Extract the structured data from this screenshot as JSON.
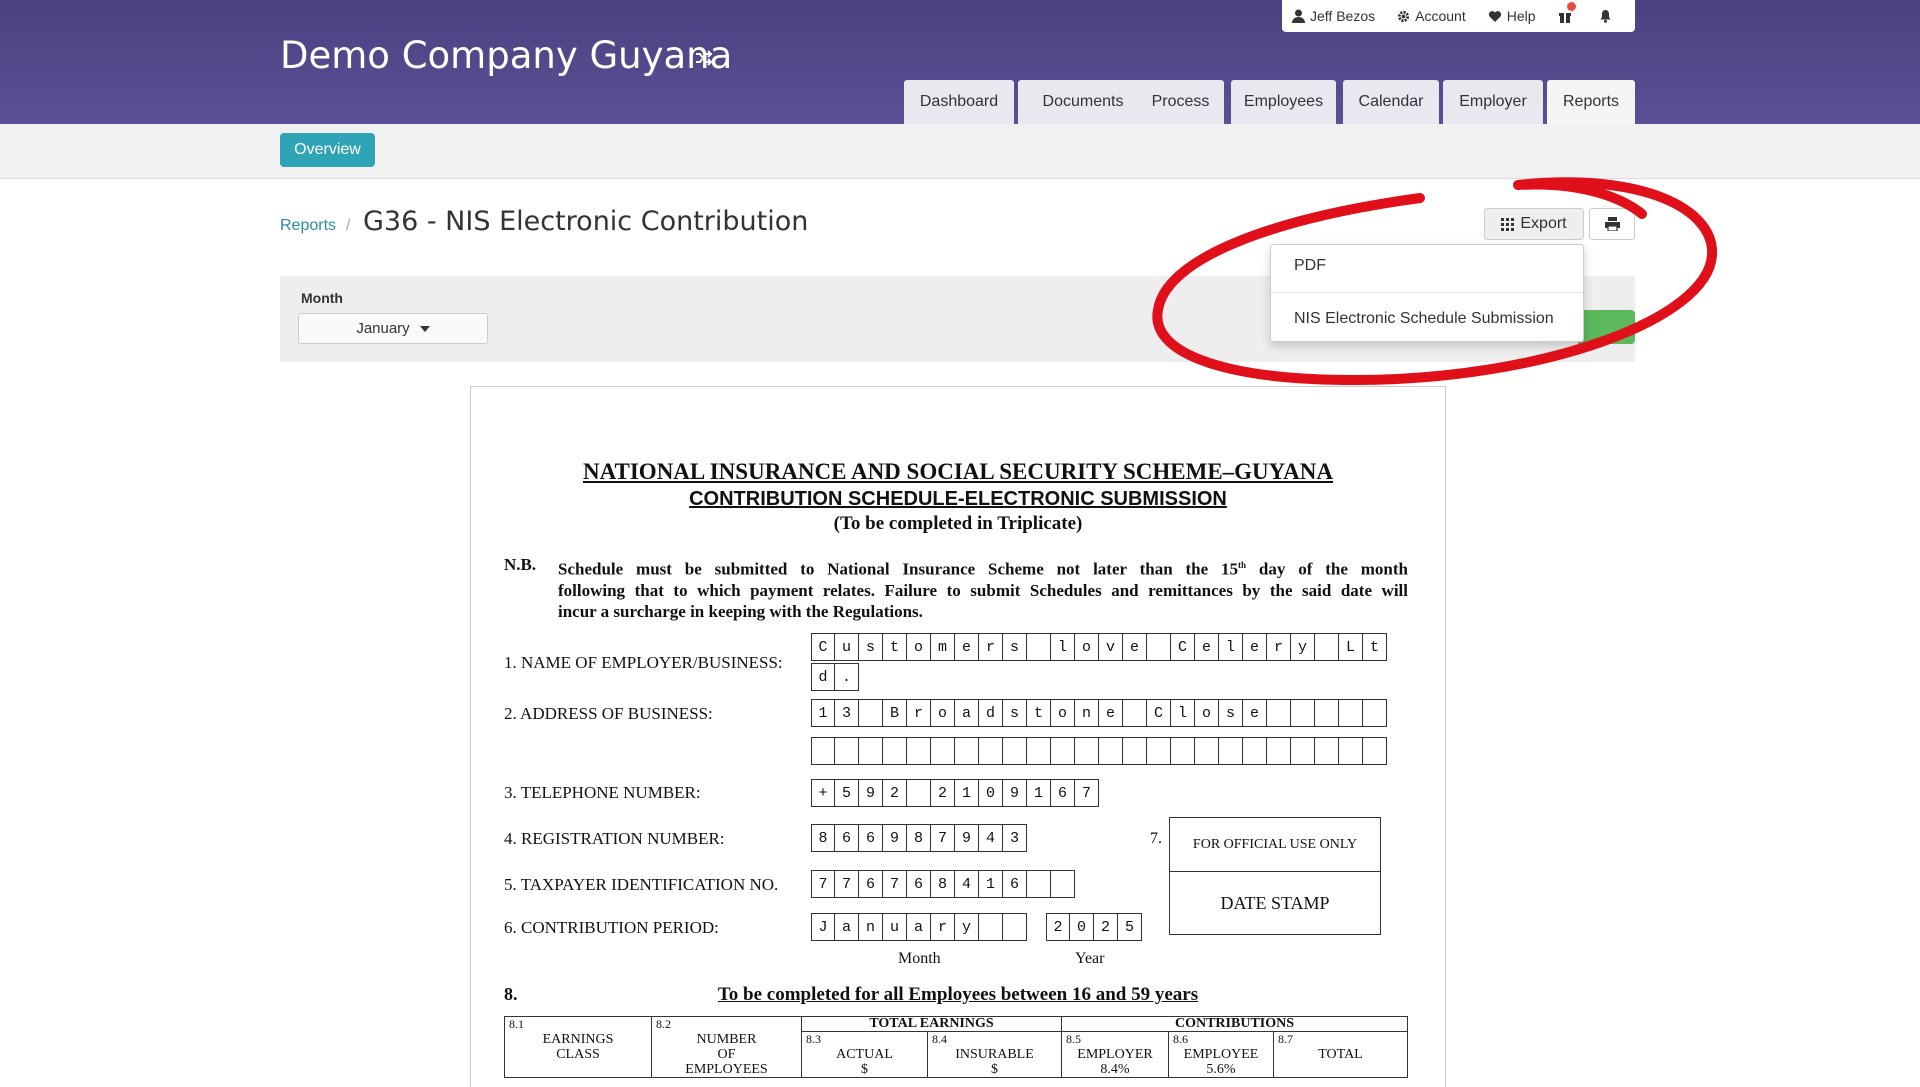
{
  "app": {
    "company": "Demo Company Guyana",
    "user": "Jeff Bezos",
    "account": "Account",
    "help": "Help"
  },
  "nav": {
    "tabs": [
      {
        "label": "Dashboard"
      },
      {
        "label": "Documents"
      },
      {
        "label": "Process"
      },
      {
        "label": "Employees"
      },
      {
        "label": "Calendar"
      },
      {
        "label": "Employer"
      },
      {
        "label": "Reports"
      }
    ],
    "active": "Reports"
  },
  "subnav": {
    "overview": "Overview"
  },
  "page": {
    "breadcrumb": "Reports",
    "separator": "/",
    "title": "G36 - NIS Electronic Contribution"
  },
  "toolbar": {
    "export": "Export",
    "menu": [
      "PDF",
      "NIS Electronic Schedule Submission"
    ]
  },
  "filter": {
    "label": "Month",
    "value": "January"
  },
  "annotation_color": "#e0101a",
  "document": {
    "title": "NATIONAL INSURANCE AND SOCIAL SECURITY SCHEME–GUYANA",
    "subtitle": "CONTRIBUTION SCHEDULE-ELECTRONIC SUBMISSION",
    "note_triplicate": "(To be completed in Triplicate)",
    "nb_label": "N.B.",
    "nb_text_1": "Schedule must be submitted to National Insurance Scheme not later than the 15",
    "nb_sup": "th",
    "nb_text_2": " day of the month",
    "nb_line_2": "following that to which payment relates. Failure to submit Schedules and remittances by the said date will",
    "nb_line_3": "incur a surcharge in keeping with the Regulations.",
    "fields": {
      "f1_label": "1. NAME OF EMPLOYER/BUSINESS:",
      "f1_line1": [
        "C",
        "u",
        "s",
        "t",
        "o",
        "m",
        "e",
        "r",
        "s",
        " ",
        "l",
        "o",
        "v",
        "e",
        " ",
        "C",
        "e",
        "l",
        "e",
        "r",
        "y",
        " ",
        "L",
        "t"
      ],
      "f1_line2": [
        "d",
        "."
      ],
      "f2_label": "2. ADDRESS OF BUSINESS:",
      "f2_line1": [
        "1",
        "3",
        " ",
        "B",
        "r",
        "o",
        "a",
        "d",
        "s",
        "t",
        "o",
        "n",
        "e",
        " ",
        "C",
        "l",
        "o",
        "s",
        "e",
        "",
        "",
        "",
        "",
        ""
      ],
      "f3_label": "3. TELEPHONE NUMBER:",
      "f3_value": [
        "+",
        "5",
        "9",
        "2",
        " ",
        "2",
        "1",
        "0",
        "9",
        "1",
        "6",
        "7"
      ],
      "f4_label": "4. REGISTRATION NUMBER:",
      "f4_value": [
        "8",
        "6",
        "6",
        "9",
        "8",
        "7",
        "9",
        "4",
        "3"
      ],
      "f5_label": "5. TAXPAYER IDENTIFICATION NO.",
      "f5_value": [
        "7",
        "7",
        "6",
        "7",
        "6",
        "8",
        "4",
        "1",
        "6",
        "",
        ""
      ],
      "f6_label": "6. CONTRIBUTION PERIOD:",
      "f6_month": [
        "J",
        "a",
        "n",
        "u",
        "a",
        "r",
        "y",
        "",
        ""
      ],
      "f6_year": [
        "2",
        "0",
        "2",
        "5"
      ],
      "month_caption": "Month",
      "year_caption": "Year",
      "f7_num": "7.",
      "official": "FOR OFFICIAL USE ONLY",
      "date_stamp": "DATE STAMP"
    },
    "section8_num": "8.",
    "section8_title": "To be completed for all Employees between 16 and 59 years",
    "table": {
      "total_earnings": "TOTAL EARNINGS",
      "contributions": "CONTRIBUTIONS",
      "cols": [
        {
          "num": "8.1",
          "l1": "EARNINGS",
          "l2": "CLASS",
          "l3": ""
        },
        {
          "num": "8.2",
          "l1": "NUMBER",
          "l2": "OF",
          "l3": "EMPLOYEES"
        },
        {
          "num": "8.3",
          "l1": "ACTUAL",
          "l2": "$",
          "l3": ""
        },
        {
          "num": "8.4",
          "l1": "INSURABLE",
          "l2": "$",
          "l3": ""
        },
        {
          "num": "8.5",
          "l1": "EMPLOYER",
          "l2": "8.4%",
          "l3": ""
        },
        {
          "num": "8.6",
          "l1": "EMPLOYEE",
          "l2": "5.6%",
          "l3": ""
        },
        {
          "num": "8.7",
          "l1": "TOTAL",
          "l2": "",
          "l3": ""
        }
      ]
    }
  }
}
